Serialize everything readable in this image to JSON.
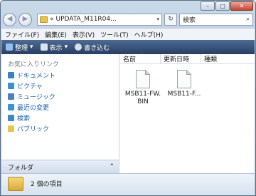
{
  "colors": {
    "toolbar_bg": "#273e63",
    "link": "#1c5fa8",
    "folder": "#e6c44f"
  },
  "caption": {
    "minimize": "–",
    "maximize": "□",
    "close": "✕"
  },
  "nav": {
    "back_icon": "arrow-left",
    "forward_icon": "arrow-right"
  },
  "address": {
    "prefix": "«",
    "path": "UPDATA_M11R04...",
    "dropdown_icon": "▾"
  },
  "refresh_icon": "↻",
  "search": {
    "placeholder": "検索",
    "icon": "⌕"
  },
  "menu": [
    "ファイル(F)",
    "編集(E)",
    "表示(V)",
    "ツール(T)",
    "ヘルプ(H)"
  ],
  "toolbar": {
    "organize": "整理",
    "view": "表示",
    "burn": "書き込む",
    "chevron": "▾"
  },
  "navpane": {
    "favorites_heading": "お気に入りリンク",
    "links": [
      {
        "label": "ドキュメント",
        "icon": "documents-icon",
        "color": "#3b7fc4"
      },
      {
        "label": "ピクチャ",
        "icon": "pictures-icon",
        "color": "#3b8fd4"
      },
      {
        "label": "ミュージック",
        "icon": "music-icon",
        "color": "#4a7fc0"
      },
      {
        "label": "最近の変更",
        "icon": "recent-icon",
        "color": "#3d8fd8"
      },
      {
        "label": "検索",
        "icon": "search-icon",
        "color": "#3f88c8"
      },
      {
        "label": "パブリック",
        "icon": "public-folder-icon",
        "color": "#e6c44f"
      }
    ],
    "folders_label": "フォルダ",
    "folders_chevron": "⌃"
  },
  "columns": {
    "name": "名前",
    "date": "更新日時",
    "type": "種類",
    "sort_caret": "^"
  },
  "files": [
    {
      "name": "MSB11-FW.\nBIN"
    },
    {
      "name": "MSB11-F..."
    }
  ],
  "status": {
    "count_text": "2 個の項目"
  }
}
